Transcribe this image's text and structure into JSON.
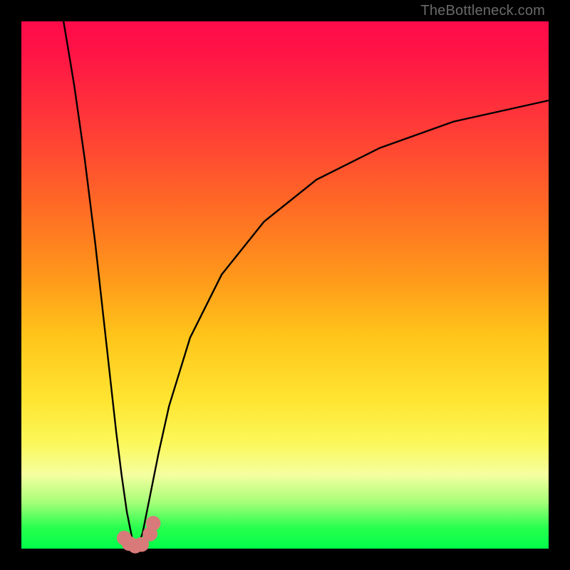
{
  "watermark": "TheBottleneck.com",
  "colors": {
    "frame": "#000000",
    "gradient_top": "#ff0a4a",
    "gradient_mid": "#ffe532",
    "gradient_bottom": "#00ff4a",
    "curve": "#000000",
    "marker": "#d97a7a"
  },
  "chart_data": {
    "type": "line",
    "title": "",
    "xlabel": "",
    "ylabel": "",
    "xlim": [
      0,
      100
    ],
    "ylim": [
      0,
      100
    ],
    "grid": false,
    "legend": false,
    "notch_x": 22,
    "series": [
      {
        "name": "left-branch",
        "x": [
          8,
          10,
          12,
          14,
          16,
          18,
          19,
          20,
          21,
          22
        ],
        "y": [
          100,
          88,
          74,
          58,
          40,
          22,
          14,
          7,
          2,
          0
        ]
      },
      {
        "name": "right-branch",
        "x": [
          22,
          23,
          24,
          26,
          28,
          32,
          38,
          46,
          56,
          68,
          82,
          100
        ],
        "y": [
          0,
          3,
          8,
          18,
          27,
          40,
          52,
          62,
          70,
          76,
          81,
          85
        ]
      }
    ],
    "markers": [
      {
        "x": 19.5,
        "y": 2.0,
        "r": 1.4
      },
      {
        "x": 20.4,
        "y": 1.0,
        "r": 1.4
      },
      {
        "x": 21.6,
        "y": 0.5,
        "r": 1.4
      },
      {
        "x": 22.8,
        "y": 0.8,
        "r": 1.4
      },
      {
        "x": 24.4,
        "y": 2.8,
        "r": 1.4
      },
      {
        "x": 25.0,
        "y": 4.8,
        "r": 1.4
      }
    ]
  }
}
